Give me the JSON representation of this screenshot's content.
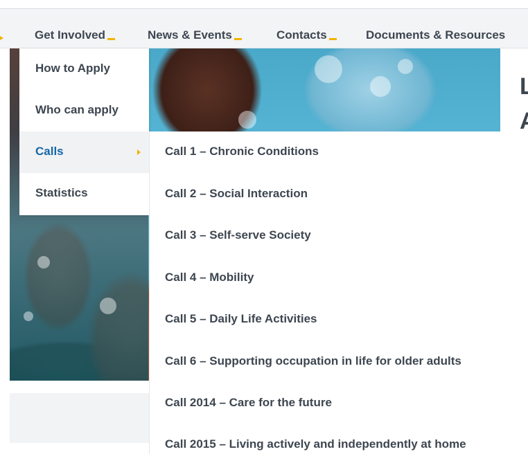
{
  "nav": {
    "items": [
      {
        "label": "Get Involved"
      },
      {
        "label": "News & Events"
      },
      {
        "label": "Contacts"
      },
      {
        "label": "Documents & Resources"
      }
    ]
  },
  "hero": {
    "title_fragment_1": "L",
    "title_fragment_2": "A"
  },
  "dropdown": {
    "items": [
      {
        "label": "How to Apply"
      },
      {
        "label": "Who can apply"
      },
      {
        "label": "Calls",
        "active": true
      },
      {
        "label": "Statistics"
      }
    ]
  },
  "submenu": {
    "items": [
      {
        "label": "Call 1 – Chronic Conditions"
      },
      {
        "label": "Call 2 – Social Interaction"
      },
      {
        "label": "Call 3 – Self-serve Society"
      },
      {
        "label": "Call 4 – Mobility"
      },
      {
        "label": "Call 5 – Daily Life Activities"
      },
      {
        "label": "Call 6 – Supporting occupation in life for older adults"
      },
      {
        "label": "Call 2014 – Care for the future"
      },
      {
        "label": "Call 2015 – Living actively and independently at home"
      }
    ]
  },
  "colors": {
    "accent": "#f2b300",
    "active_text": "#1567a8",
    "text": "#3d4650",
    "nav_bg": "#f3f4f6"
  }
}
